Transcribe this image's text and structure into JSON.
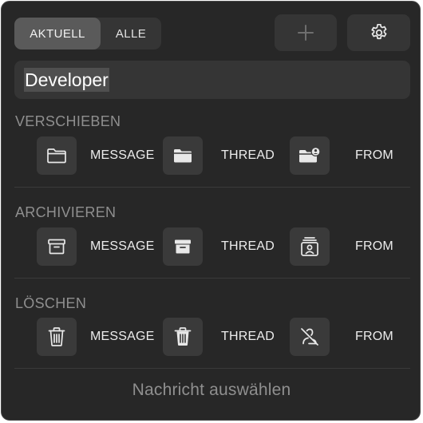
{
  "tabs": [
    {
      "label": "AKTUELL",
      "active": true
    },
    {
      "label": "ALLE",
      "active": false
    }
  ],
  "toolbar": {
    "add_icon": "plus-icon",
    "settings_icon": "gear-icon"
  },
  "search": {
    "value": "Developer"
  },
  "sections": [
    {
      "title": "VERSCHIEBEN",
      "actions": [
        {
          "icon": "folder-outline-icon",
          "label": "MESSAGE"
        },
        {
          "icon": "folder-filled-icon",
          "label": "THREAD"
        },
        {
          "icon": "folder-person-icon",
          "label": "FROM"
        }
      ]
    },
    {
      "title": "ARCHIVIEREN",
      "actions": [
        {
          "icon": "archive-outline-icon",
          "label": "MESSAGE"
        },
        {
          "icon": "archive-filled-icon",
          "label": "THREAD"
        },
        {
          "icon": "contact-card-icon",
          "label": "FROM"
        }
      ]
    },
    {
      "title": "LÖSCHEN",
      "actions": [
        {
          "icon": "trash-outline-icon",
          "label": "MESSAGE"
        },
        {
          "icon": "trash-filled-icon",
          "label": "THREAD"
        },
        {
          "icon": "person-slash-icon",
          "label": "FROM"
        }
      ]
    }
  ],
  "footer": {
    "status": "Nachricht auswählen"
  },
  "colors": {
    "panel_bg": "#272727",
    "control_bg": "#353535",
    "active_tab": "#5a5a5a",
    "muted_text": "#8f8f8f",
    "icon": "#e8e8e8"
  }
}
